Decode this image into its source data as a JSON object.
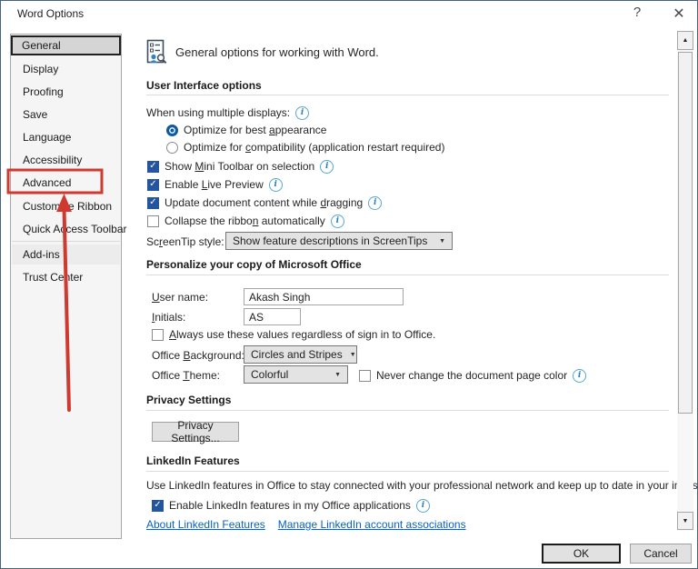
{
  "titlebar": {
    "title": "Word Options"
  },
  "icons": {
    "help": "?",
    "close": "✕",
    "check": "✓",
    "dropdown_arrow": "▼",
    "up_arrow": "▲",
    "down_arrow": "▼",
    "info": "i"
  },
  "sidebar": {
    "items": [
      {
        "label": "General",
        "selected": true
      },
      {
        "label": "Display"
      },
      {
        "label": "Proofing"
      },
      {
        "label": "Save"
      },
      {
        "label": "Language"
      },
      {
        "label": "Accessibility"
      },
      {
        "label": "Advanced",
        "annotated": true
      },
      {
        "label": "Customize Ribbon"
      },
      {
        "label": "Quick Access Toolbar"
      },
      {
        "label": "Add-ins"
      },
      {
        "label": "Trust Center"
      }
    ]
  },
  "header": {
    "title": "General options for working with Word."
  },
  "ui_options": {
    "title": "User Interface options",
    "multi_display": "When using multiple displays:",
    "radio_appearance": {
      "pre": "Optimize for best ",
      "key": "a",
      "post": "ppearance",
      "checked": true
    },
    "radio_compatibility": {
      "pre": "Optimize for ",
      "key": "c",
      "post": "ompatibility (application restart required)",
      "checked": false
    },
    "show_mini": {
      "pre": "Show ",
      "key": "M",
      "post": "ini Toolbar on selection",
      "checked": true
    },
    "live_preview": {
      "pre": "Enable ",
      "key": "L",
      "post": "ive Preview",
      "checked": true
    },
    "update_drag": {
      "pre": "Update document content while ",
      "key": "d",
      "post": "ragging",
      "checked": true
    },
    "collapse_ribbon": {
      "pre": "Collapse the ribbo",
      "key": "n",
      "post": " automatically",
      "checked": false
    },
    "screentip_label": {
      "pre": "Sc",
      "key": "r",
      "post": "eenTip style:"
    },
    "screentip_value": "Show feature descriptions in ScreenTips"
  },
  "personalize": {
    "title": "Personalize your copy of Microsoft Office",
    "user_name_label": {
      "pre": "",
      "key": "U",
      "post": "ser name:"
    },
    "user_name_value": "Akash Singh",
    "initials_label": {
      "pre": "",
      "key": "I",
      "post": "nitials:"
    },
    "initials_value": "AS",
    "always_label": {
      "pre": "",
      "key": "A",
      "post": "lways use these values regardless of sign in to Office.",
      "checked": false
    },
    "office_bg_label": {
      "pre": "Office ",
      "key": "B",
      "post": "ackground:"
    },
    "office_bg_value": "Circles and Stripes",
    "office_theme_label": {
      "pre": "Office ",
      "key": "T",
      "post": "heme:"
    },
    "office_theme_value": "Colorful",
    "never_change_label": "Never change the document page color",
    "never_change_checked": false
  },
  "privacy": {
    "title": "Privacy Settings",
    "button_label": "Privacy Settings..."
  },
  "linkedin": {
    "title": "LinkedIn Features",
    "description": "Use LinkedIn features in Office to stay connected with your professional network and keep up to date in your industry.",
    "enable_label": "Enable LinkedIn features in my Office applications",
    "enable_checked": true,
    "link_about": "About LinkedIn Features",
    "link_manage": "Manage LinkedIn account associations"
  },
  "footer": {
    "ok": "OK",
    "cancel": "Cancel"
  },
  "colors": {
    "annotation_red": "#d0392f",
    "dialog_border": "#44637f",
    "check_blue": "#2456a0",
    "radio_blue": "#0c5ba3",
    "link_blue": "#0563c1",
    "info_blue": "#2f7fb5"
  }
}
